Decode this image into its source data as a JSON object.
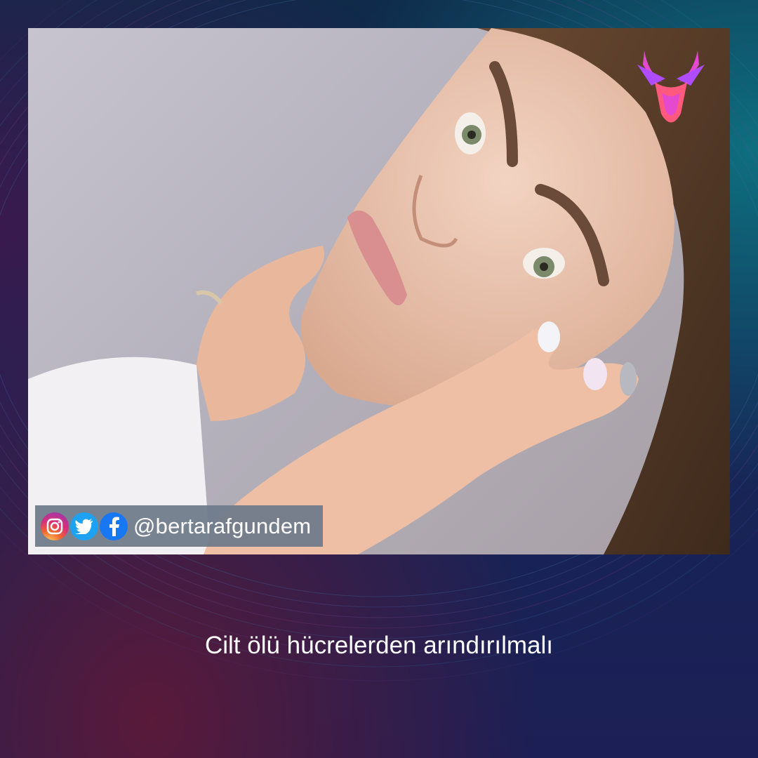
{
  "photo": {
    "subject": "woman-portrait-hands-on-face"
  },
  "logo": {
    "icon": "deer-antler-logo-icon",
    "colors": [
      "#e44ad0",
      "#ff5a7e",
      "#b04cff"
    ]
  },
  "social": {
    "icons": [
      "instagram-icon",
      "twitter-icon",
      "facebook-icon"
    ],
    "handle": "@bertarafgundem"
  },
  "caption": {
    "text": "Cilt ölü hücrelerden arındırılmalı"
  },
  "colors": {
    "instagram": "#d8317a",
    "twitter": "#1da1f2",
    "facebook": "#1877f2",
    "bar": "#6e7a8a"
  }
}
